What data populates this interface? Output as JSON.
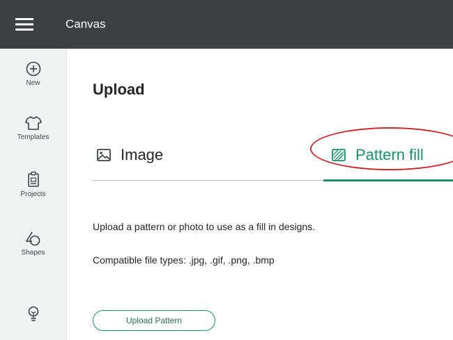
{
  "topbar": {
    "title": "Canvas",
    "menu_icon": "hamburger-menu-icon"
  },
  "sidebar": {
    "items": [
      {
        "label": "New",
        "icon": "plus-circle-icon"
      },
      {
        "label": "Templates",
        "icon": "shirt-icon"
      },
      {
        "label": "Projects",
        "icon": "clipboard-icon"
      },
      {
        "label": "Shapes",
        "icon": "shapes-icon"
      },
      {
        "label": "",
        "icon": "lightbulb-icon"
      }
    ]
  },
  "main": {
    "title": "Upload",
    "tabs": [
      {
        "label": "Image",
        "icon": "image-icon",
        "active": false
      },
      {
        "label": "Pattern fill",
        "icon": "pattern-icon",
        "active": true
      }
    ],
    "description": "Upload a pattern or photo to use as a fill in designs.",
    "file_types": "Compatible file types: .jpg, .gif, .png, .bmp",
    "upload_button": "Upload Pattern"
  },
  "colors": {
    "topbar_bg": "#3d4043",
    "sidebar_bg": "#f1f2f2",
    "accent_green": "#1b8e6a",
    "callout_red": "#c8262b"
  }
}
